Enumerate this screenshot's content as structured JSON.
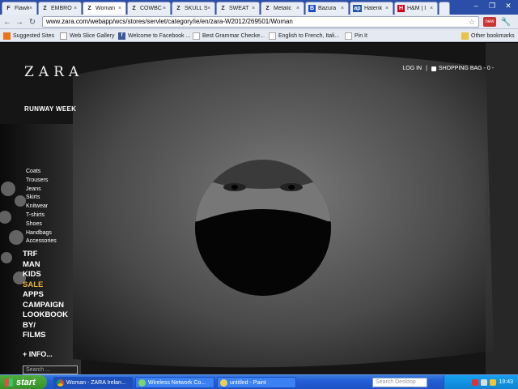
{
  "browser": {
    "tabs": [
      {
        "label": "Flawles",
        "favicon": "F"
      },
      {
        "label": "EMBRO",
        "favicon": "Z"
      },
      {
        "label": "Woman",
        "favicon": "Z",
        "active": true
      },
      {
        "label": "COWBC",
        "favicon": "Z"
      },
      {
        "label": "SKULL S",
        "favicon": "Z"
      },
      {
        "label": "SWEAT",
        "favicon": "Z"
      },
      {
        "label": "Metalic",
        "favicon": "Z"
      },
      {
        "label": "Bazura",
        "favicon": "B"
      },
      {
        "label": "Hatenk",
        "favicon": "ap"
      },
      {
        "label": "H&M | I",
        "favicon": "H"
      }
    ],
    "address": "www.zara.com/webapp/wcs/stores/servlet/category/ie/en/zara-W2012/269501/Woman",
    "bookmarks": [
      {
        "label": "Suggested Sites",
        "icon": "suggested-icon"
      },
      {
        "label": "Web Slice Gallery",
        "icon": "webslice-icon"
      },
      {
        "label": "Welcome to Facebook ...",
        "icon": "facebook-icon"
      },
      {
        "label": "Best Grammar Checke...",
        "icon": "page-icon"
      },
      {
        "label": "English to French, Itali...",
        "icon": "page-icon"
      },
      {
        "label": "Pin It",
        "icon": "page-icon"
      },
      {
        "label": "Other bookmarks",
        "icon": "folder-icon"
      }
    ],
    "colors": {
      "chrome_blue": "#2b4fa8",
      "toolbar": "#e4e9f2"
    }
  },
  "site": {
    "logo": "ZARA",
    "login": "LOG IN",
    "separator": "|",
    "bag": "SHOPPING BAG - 0 -",
    "runway": "RUNWAY WEEK",
    "subnav": [
      "Coats",
      "Trousers",
      "Jeans",
      "Skirts",
      "Knitwear",
      "T-shirts",
      "Shoes",
      "Handbags",
      "Accessories"
    ],
    "mainnav": [
      "TRF",
      "MAN",
      "KIDS",
      "SALE",
      "APPS",
      "CAMPAIGN",
      "LOOKBOOK",
      "BY/",
      "FILMS"
    ],
    "info": "+ INFO...",
    "search_placeholder": "Search ...",
    "sale_color": "#e8b33c"
  },
  "taskbar": {
    "start": "start",
    "tasks": [
      {
        "label": "Woman - ZARA Irelan...",
        "icon": "chrome-icon",
        "active": true
      },
      {
        "label": "Wireless Network Co...",
        "icon": "wireless-icon"
      },
      {
        "label": "untitled - Paint",
        "icon": "paint-icon"
      }
    ],
    "search": "Search Desktop",
    "clock": "19:43"
  }
}
